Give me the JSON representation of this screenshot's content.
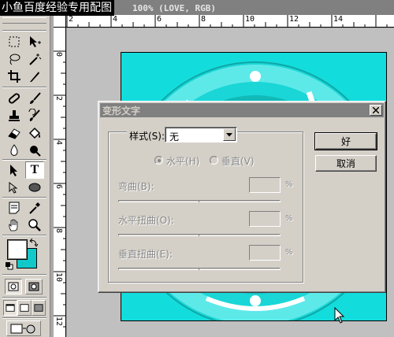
{
  "watermark": "小鱼百度经验专用配图",
  "document": {
    "title": "100% (LOVE, RGB)"
  },
  "rulers": {
    "top": [
      "2",
      "4",
      "6",
      "8",
      "10",
      "12",
      "14"
    ],
    "left": [
      "0",
      "2",
      "4",
      "6",
      "8",
      "10",
      "12"
    ]
  },
  "colors": {
    "foreground": "#ffffff",
    "background": "#13c8c8",
    "canvas": "#13dcdc"
  },
  "toolbox": {
    "tools": [
      "marquee-icon",
      "move-icon",
      "lasso-icon",
      "magic-wand-icon",
      "crop-icon",
      "slice-icon",
      "healing-brush-icon",
      "brush-icon",
      "clone-stamp-icon",
      "history-brush-icon",
      "eraser-icon",
      "paint-bucket-icon",
      "blur-icon",
      "dodge-icon",
      "path-selection-icon",
      "type-icon",
      "pen-icon",
      "shape-icon",
      "notes-icon",
      "eyedropper-icon",
      "hand-icon",
      "zoom-icon"
    ],
    "type_tool_glyph": "T"
  },
  "dialog": {
    "title": "变形文字",
    "style_label": "样式(S):",
    "style_value": "无",
    "orientation": {
      "horizontal": "水平(H)",
      "vertical": "垂直(V)",
      "selected": "horizontal"
    },
    "params": [
      {
        "label": "弯曲(B):",
        "value": "",
        "unit": "%"
      },
      {
        "label": "水平扭曲(O):",
        "value": "",
        "unit": "%"
      },
      {
        "label": "垂直扭曲(E):",
        "value": "",
        "unit": "%"
      }
    ],
    "ok_label": "好",
    "cancel_label": "取消"
  }
}
